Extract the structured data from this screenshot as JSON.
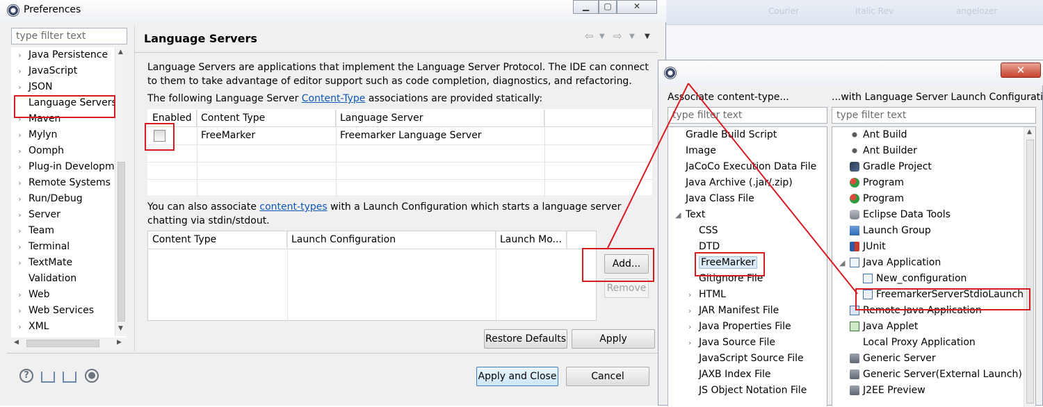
{
  "background": {
    "ghost_texts": [
      "Courier",
      "Italic Rev",
      "angelozer"
    ]
  },
  "preferences": {
    "title": "Preferences",
    "window_buttons": [
      "▁",
      "▢",
      "✕"
    ],
    "filter_placeholder": "type filter text",
    "tree_items": [
      {
        "label": "Java Persistence",
        "expandable": true
      },
      {
        "label": "JavaScript",
        "expandable": true
      },
      {
        "label": "JSON",
        "expandable": true
      },
      {
        "label": "Language Servers",
        "expandable": false,
        "selected": true
      },
      {
        "label": "Maven",
        "expandable": true
      },
      {
        "label": "Mylyn",
        "expandable": true
      },
      {
        "label": "Oomph",
        "expandable": true
      },
      {
        "label": "Plug-in Developm",
        "expandable": true
      },
      {
        "label": "Remote Systems",
        "expandable": true
      },
      {
        "label": "Run/Debug",
        "expandable": true
      },
      {
        "label": "Server",
        "expandable": true
      },
      {
        "label": "Team",
        "expandable": true
      },
      {
        "label": "Terminal",
        "expandable": true
      },
      {
        "label": "TextMate",
        "expandable": true
      },
      {
        "label": "Validation",
        "expandable": false
      },
      {
        "label": "Web",
        "expandable": true
      },
      {
        "label": "Web Services",
        "expandable": true
      },
      {
        "label": "XML",
        "expandable": true
      }
    ],
    "page_title": "Language Servers",
    "description": "Language Servers are applications that implement the Language Server Protocol. The IDE can connect to them to take advantage of editor support such as code completion, diagnostics, and refactoring.",
    "static_prefix": "The following Language Server ",
    "static_link": "Content-Type",
    "static_suffix": " associations are provided statically:",
    "static_table": {
      "headers": [
        "Enabled",
        "Content Type",
        "Language Server"
      ],
      "rows": [
        {
          "enabled": false,
          "content_type": "FreeMarker",
          "language_server": "Freemarker Language Server"
        }
      ]
    },
    "launch_prefix": "You can also associate ",
    "launch_link": "content-types",
    "launch_suffix": " with a Launch Configuration which starts a language server chatting via stdin/stdout.",
    "launch_table": {
      "headers": [
        "Content Type",
        "Launch Configuration",
        "Launch Mo..."
      ]
    },
    "add_label": "Add...",
    "remove_label": "Remove",
    "restore_label": "Restore Defaults",
    "apply_label": "Apply",
    "apply_close_label": "Apply and Close",
    "cancel_label": "Cancel"
  },
  "association_dialog": {
    "close_label": "✕",
    "left_header": "Associate content-type...",
    "right_header": "...with Language Server Launch Configuration",
    "left_filter_placeholder": "type filter text",
    "right_filter_placeholder": "type filter text",
    "content_types": [
      {
        "label": "Gradle Build Script",
        "indent": 0,
        "arrow": ""
      },
      {
        "label": "Image",
        "indent": 0,
        "arrow": ""
      },
      {
        "label": "JaCoCo Execution Data File",
        "indent": 0,
        "arrow": ""
      },
      {
        "label": "Java Archive (.jar/.zip)",
        "indent": 0,
        "arrow": ""
      },
      {
        "label": "Java Class File",
        "indent": 0,
        "arrow": ""
      },
      {
        "label": "Text",
        "indent": 0,
        "arrow": "◢"
      },
      {
        "label": "CSS",
        "indent": 1,
        "arrow": ""
      },
      {
        "label": "DTD",
        "indent": 1,
        "arrow": ""
      },
      {
        "label": "FreeMarker",
        "indent": 1,
        "arrow": "",
        "selected": true
      },
      {
        "label": "Gitignore File",
        "indent": 1,
        "arrow": ""
      },
      {
        "label": "HTML",
        "indent": 1,
        "arrow": "›"
      },
      {
        "label": "JAR Manifest File",
        "indent": 1,
        "arrow": "›"
      },
      {
        "label": "Java Properties File",
        "indent": 1,
        "arrow": "›"
      },
      {
        "label": "Java Source File",
        "indent": 1,
        "arrow": "›"
      },
      {
        "label": "JavaScript Source File",
        "indent": 1,
        "arrow": ""
      },
      {
        "label": "JAXB Index File",
        "indent": 1,
        "arrow": ""
      },
      {
        "label": "JS Object Notation File",
        "indent": 1,
        "arrow": ""
      }
    ],
    "launch_configs": [
      {
        "label": "Ant Build",
        "indent": 0,
        "arrow": "",
        "icon": "ant-icon"
      },
      {
        "label": "Ant Builder",
        "indent": 0,
        "arrow": "",
        "icon": "ant-icon"
      },
      {
        "label": "Gradle Project",
        "indent": 0,
        "arrow": "",
        "icon": "gradle-icon"
      },
      {
        "label": "Program",
        "indent": 0,
        "arrow": "",
        "icon": "program-icon"
      },
      {
        "label": "Program",
        "indent": 0,
        "arrow": "",
        "icon": "program-icon"
      },
      {
        "label": "Eclipse Data Tools",
        "indent": 0,
        "arrow": "",
        "icon": "database-icon"
      },
      {
        "label": "Launch Group",
        "indent": 0,
        "arrow": "",
        "icon": "launch-group-icon"
      },
      {
        "label": "JUnit",
        "indent": 0,
        "arrow": "",
        "icon": "junit-icon"
      },
      {
        "label": "Java Application",
        "indent": 0,
        "arrow": "◢",
        "icon": "java-app-icon"
      },
      {
        "label": "New_configuration",
        "indent": 1,
        "arrow": "",
        "icon": "java-app-icon"
      },
      {
        "label": "FreemarkerServerStdioLauncher",
        "indent": 1,
        "arrow": "",
        "icon": "java-app-icon",
        "selected": true
      },
      {
        "label": "Remote Java Application",
        "indent": 0,
        "arrow": "",
        "icon": "remote-java-icon"
      },
      {
        "label": "Java Applet",
        "indent": 0,
        "arrow": "",
        "icon": "applet-icon"
      },
      {
        "label": "Local Proxy Application",
        "indent": 0,
        "arrow": "",
        "icon": "blank-icon"
      },
      {
        "label": "Generic Server",
        "indent": 0,
        "arrow": "",
        "icon": "server-icon"
      },
      {
        "label": "Generic Server(External Launch)",
        "indent": 0,
        "arrow": "",
        "icon": "server-icon"
      },
      {
        "label": "J2EE Preview",
        "indent": 0,
        "arrow": "",
        "icon": "server-icon"
      }
    ]
  }
}
